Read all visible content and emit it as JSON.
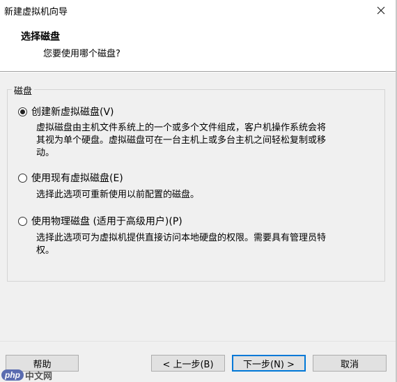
{
  "window": {
    "title": "新建虚拟机向导"
  },
  "header": {
    "title": "选择磁盘",
    "subtitle": "您要使用哪个磁盘?"
  },
  "group": {
    "label": "磁盘"
  },
  "options": [
    {
      "label": "创建新虚拟磁盘(V)",
      "checked": true,
      "desc_lines": [
        "虚拟磁盘由主机文件系统上的一个或多个文件组成，客户机操作系统会将",
        "其视为单个硬盘。虚拟磁盘可在一台主机上或多台主机之间轻松复制或移",
        "动。"
      ]
    },
    {
      "label": "使用现有虚拟磁盘(E)",
      "checked": false,
      "desc_lines": [
        "选择此选项可重新使用以前配置的磁盘。"
      ]
    },
    {
      "label": "使用物理磁盘 (适用于高级用户)(P)",
      "checked": false,
      "desc_lines": [
        "选择此选项可为虚拟机提供直接访问本地硬盘的权限。需要具有管理员特",
        "权。"
      ]
    }
  ],
  "buttons": {
    "help": "帮助",
    "back": "< 上一步(B)",
    "next": "下一步(N) >",
    "cancel": "取消"
  },
  "watermark": {
    "logo": "php",
    "text": "中文网"
  }
}
